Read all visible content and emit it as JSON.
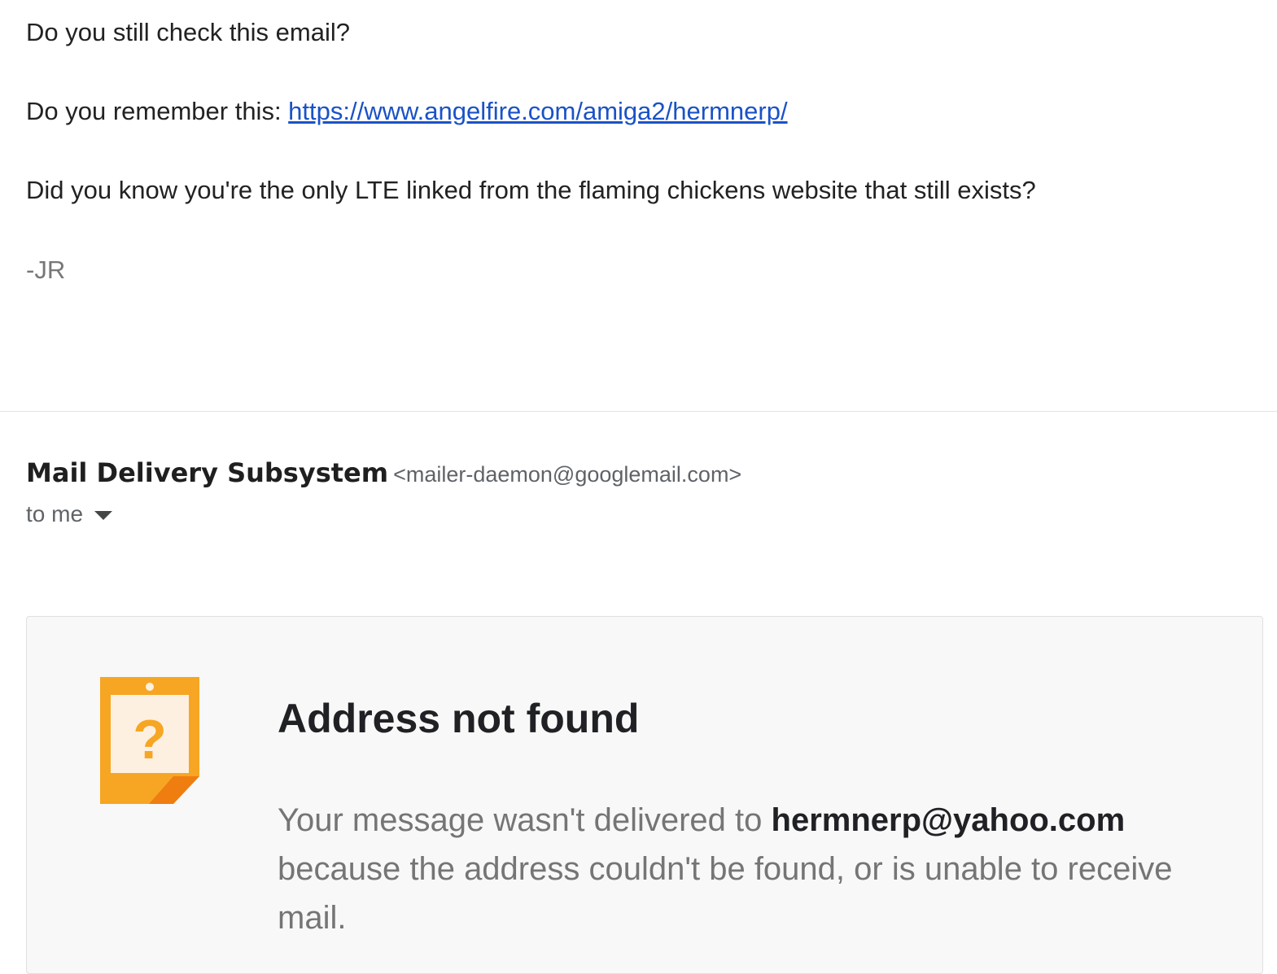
{
  "message": {
    "line1": "Do you still check this email?",
    "line2_prefix": "Do you remember this: ",
    "line2_link": "https://www.angelfire.com/amiga2/hermnerp/",
    "line3": "Did you know you're the only LTE linked from the flaming chickens website that still exists?",
    "signature": "-JR"
  },
  "reply": {
    "sender_name": "Mail Delivery Subsystem",
    "sender_email": "<mailer-daemon@googlemail.com>",
    "recipients_label": "to me",
    "recipients_icon": "caret-down-icon"
  },
  "bounce": {
    "icon": "address-not-found-icon",
    "title": "Address not found",
    "text_prefix": "Your message wasn't delivered to ",
    "address": "hermnerp@yahoo.com",
    "text_suffix": " because the address couldn't be found, or is unable to receive mail."
  },
  "colors": {
    "link": "#1a52c6",
    "icon_orange": "#f6a623",
    "card_background": "#f8f8f8"
  }
}
